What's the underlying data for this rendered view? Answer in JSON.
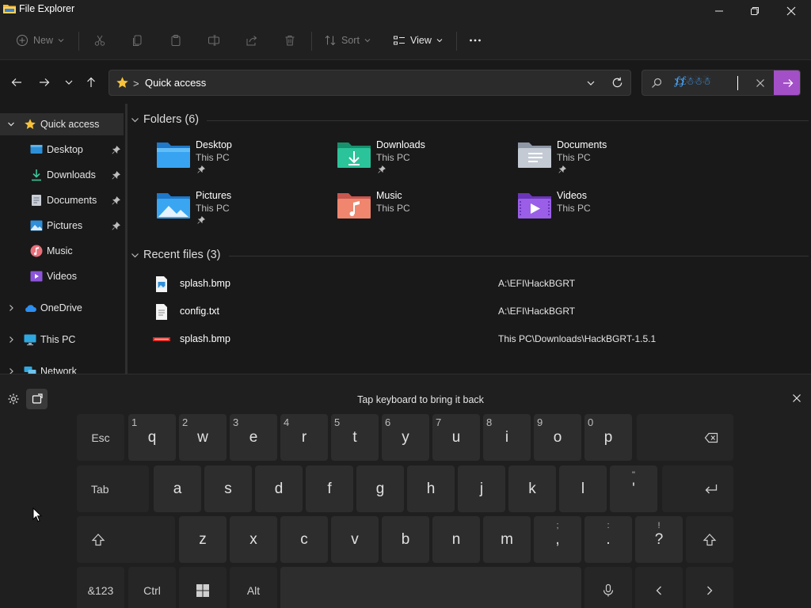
{
  "window": {
    "title": "File Explorer"
  },
  "toolbar": {
    "new_label": "New",
    "sort_label": "Sort",
    "view_label": "View"
  },
  "address": {
    "location": "Quick access",
    "separator": ">"
  },
  "search": {
    "value": "⨋⨋☃☃☃"
  },
  "sidebar": {
    "items": [
      {
        "label": "Quick access"
      },
      {
        "label": "Desktop"
      },
      {
        "label": "Downloads"
      },
      {
        "label": "Documents"
      },
      {
        "label": "Pictures"
      },
      {
        "label": "Music"
      },
      {
        "label": "Videos"
      },
      {
        "label": "OneDrive"
      },
      {
        "label": "This PC"
      },
      {
        "label": "Network"
      }
    ]
  },
  "folders": {
    "title": "Folders (6)",
    "items": [
      {
        "name": "Desktop",
        "location": "This PC",
        "pinned": true
      },
      {
        "name": "Downloads",
        "location": "This PC",
        "pinned": true
      },
      {
        "name": "Documents",
        "location": "This PC",
        "pinned": true
      },
      {
        "name": "Pictures",
        "location": "This PC",
        "pinned": true
      },
      {
        "name": "Music",
        "location": "This PC",
        "pinned": false
      },
      {
        "name": "Videos",
        "location": "This PC",
        "pinned": false
      }
    ]
  },
  "recent": {
    "title": "Recent files (3)",
    "items": [
      {
        "name": "splash.bmp",
        "path": "A:\\EFI\\HackBGRT"
      },
      {
        "name": "config.txt",
        "path": "A:\\EFI\\HackBGRT"
      },
      {
        "name": "splash.bmp",
        "path": "This PC\\Downloads\\HackBGRT-1.5.1"
      }
    ]
  },
  "keyboard": {
    "hint": "Tap keyboard to bring it back",
    "row1": {
      "esc": "Esc",
      "keys": [
        "q",
        "w",
        "e",
        "r",
        "t",
        "y",
        "u",
        "i",
        "o",
        "p"
      ],
      "nums": [
        "1",
        "2",
        "3",
        "4",
        "5",
        "6",
        "7",
        "8",
        "9",
        "0"
      ]
    },
    "row2": {
      "tab": "Tab",
      "keys": [
        "a",
        "s",
        "d",
        "f",
        "g",
        "h",
        "j",
        "k",
        "l"
      ],
      "quote_top": "\"",
      "quote": "'"
    },
    "row3": {
      "keys": [
        "z",
        "x",
        "c",
        "v",
        "b",
        "n",
        "m"
      ],
      "comma": ",",
      "comma_top": ";",
      "period": ".",
      "period_top": ":",
      "question": "?",
      "question_top": "!"
    },
    "row4": {
      "sym": "&123",
      "ctrl": "Ctrl",
      "alt": "Alt"
    }
  },
  "colors": {
    "accent": "#a34fc7",
    "background": "#191919",
    "toolbar": "#202020",
    "key": "#2d2d2d"
  }
}
